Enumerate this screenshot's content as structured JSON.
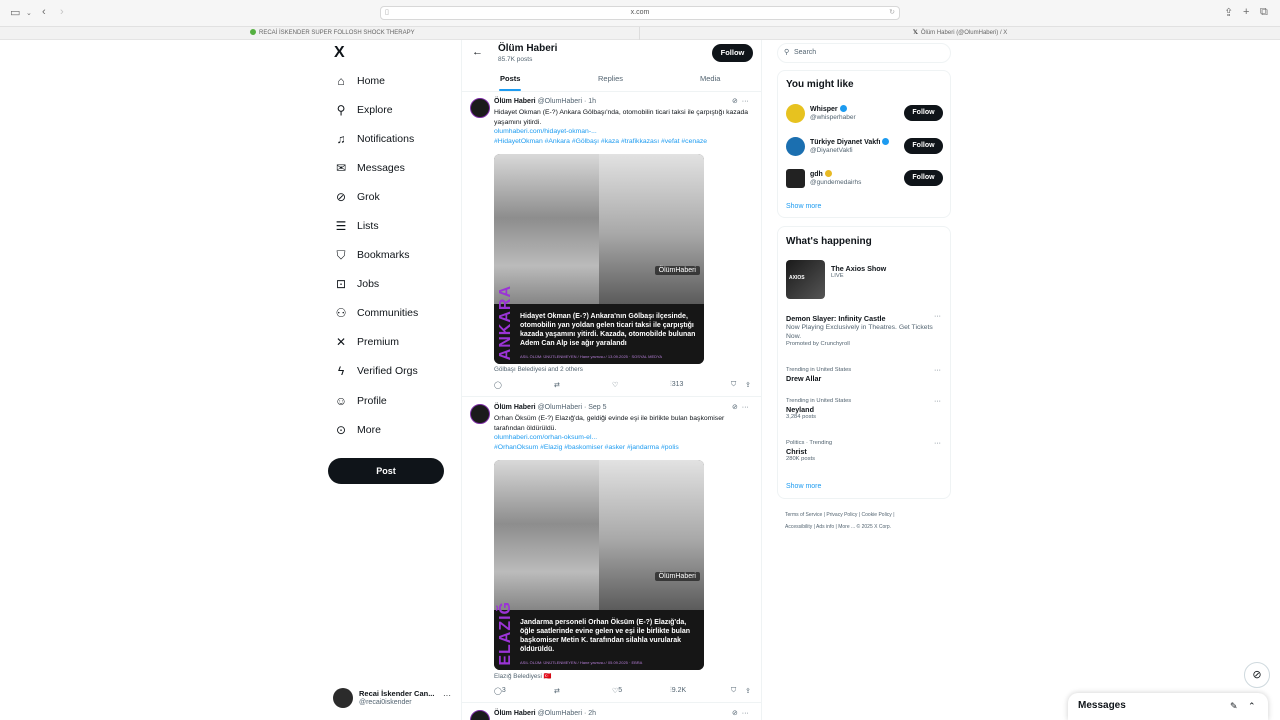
{
  "browser": {
    "url": "x.com",
    "tabs": [
      {
        "label": "RECAİ İSKENDER SUPER FOLLOSH SHOCK THERAPY"
      },
      {
        "label": "Ölüm Haberi (@OlumHaberi) / X"
      }
    ]
  },
  "nav": {
    "logo": "X",
    "items": [
      {
        "label": "Home",
        "icon": "home-icon"
      },
      {
        "label": "Explore",
        "icon": "search-icon"
      },
      {
        "label": "Notifications",
        "icon": "bell-icon"
      },
      {
        "label": "Messages",
        "icon": "mail-icon"
      },
      {
        "label": "Grok",
        "icon": "grok-icon"
      },
      {
        "label": "Lists",
        "icon": "list-icon"
      },
      {
        "label": "Bookmarks",
        "icon": "bookmark-icon"
      },
      {
        "label": "Jobs",
        "icon": "briefcase-icon"
      },
      {
        "label": "Communities",
        "icon": "people-icon"
      },
      {
        "label": "Premium",
        "icon": "x-icon"
      },
      {
        "label": "Verified Orgs",
        "icon": "lightning-icon"
      },
      {
        "label": "Profile",
        "icon": "person-icon"
      },
      {
        "label": "More",
        "icon": "more-circle-icon"
      }
    ],
    "post_label": "Post",
    "account": {
      "name": "Recai İskender Can...",
      "handle": "@recai0iskender"
    }
  },
  "profile": {
    "name": "Ölüm Haberi",
    "posts_count": "85.7K posts",
    "follow_label": "Follow",
    "tabs": [
      "Posts",
      "Replies",
      "Media"
    ]
  },
  "tweets": [
    {
      "name": "Ölüm Haberi",
      "meta": "@OlumHaberi · 1h",
      "text": "Hidayet Okman (E-?) Ankara Gölbaşı'nda, otomobilin ticari taksi ile çarpıştığı kazada yaşamını yitirdi.",
      "link": "olumhaberi.com/hidayet-okman-...",
      "hashtags": "#HidayetOkman #Ankara #Gölbaşı #kaza #trafikkazası #vefat #cenaze",
      "image_city": "ANKARA",
      "image_brand": "ÖlümHaberi",
      "image_caption": "Hidayet Okman (E-?) Ankara'nın Gölbaşı ilçesinde, otomobilin yan yoldan gelen ticari taksi ile çarpıştığı kazada yaşamını yitirdi. Kazada, otomobilde bulunan Adem Can Alp ise ağır yaralandı",
      "image_source": "ASIL ÖLÜM: ÜNÜTLENMEYEN / Hane yavrusu / 13.09.2025 · SOSYAL MEDYA",
      "tagged": "Gölbaşı Belediyesi and 2 others",
      "replies": "",
      "reposts": "",
      "likes": "",
      "views": "313"
    },
    {
      "name": "Ölüm Haberi",
      "meta": "@OlumHaberi · Sep 5",
      "text": "Orhan Öksüm (E-?) Elazığ'da, geldiği evinde eşi ile birlikte bulan başkomiser tarafından öldürüldü.",
      "link": "olumhaberi.com/orhan-oksum-el...",
      "hashtags": "#OrhanOksum #Elazig #baskomiser #asker #jandarma #polis",
      "image_city": "ELAZIĞ",
      "image_brand": "ÖlümHaberi",
      "image_caption": "Jandarma personeli Orhan Öksüm (E-?) Elazığ'da, öğle saatlerinde evine gelen ve eşi ile birlikte bulan başkomiser Metin K. tarafından silahla vurularak öldürüldü.",
      "image_source": "ASIL ÖLÜM: ÜNÜTLENMEYEN / Hane yavrusu / 05.09.2025 · EBRA",
      "tagged": "Elazığ Belediyesi 🇹🇷",
      "replies": "3",
      "reposts": "",
      "likes": "5",
      "views": "9.2K"
    },
    {
      "name": "Ölüm Haberi",
      "meta": "@OlumHaberi · 2h"
    }
  ],
  "sidebar": {
    "search_placeholder": "Search",
    "you_might_like": "You might like",
    "suggestions": [
      {
        "name": "Whisper",
        "handle": "@whisperhaber",
        "badge": "blue",
        "avatar_color": "#e7c21f"
      },
      {
        "name": "Türkiye Diyanet Vakfı",
        "handle": "@DiyanetVakfi",
        "badge": "blue",
        "avatar_color": "#1b6fb0"
      },
      {
        "name": "gdh",
        "handle": "@gundemedairhs",
        "badge": "gold",
        "avatar_color": "#222222"
      }
    ],
    "follow_label": "Follow",
    "show_more": "Show more",
    "whats_happening": "What's happening",
    "axios": {
      "title": "The Axios Show",
      "status": "LIVE",
      "thumb_text": "AXIOS"
    },
    "promoted": {
      "title": "Demon Slayer: Infinity Castle",
      "desc": "Now Playing Exclusively in Theatres. Get Tickets Now.",
      "by": "Promoted by Crunchyroll"
    },
    "trends": [
      {
        "context": "Trending in United States",
        "title": "Drew Allar",
        "count": ""
      },
      {
        "context": "Trending in United States",
        "title": "Neyland",
        "count": "3,284 posts"
      },
      {
        "context": "Politics · Trending",
        "title": "Christ",
        "count": "280K posts"
      }
    ],
    "footer": [
      "Terms of Service",
      "Privacy Policy",
      "Cookie Policy",
      "Accessibility",
      "Ads info",
      "More ...",
      "© 2025 X Corp."
    ]
  },
  "messages": {
    "label": "Messages"
  }
}
